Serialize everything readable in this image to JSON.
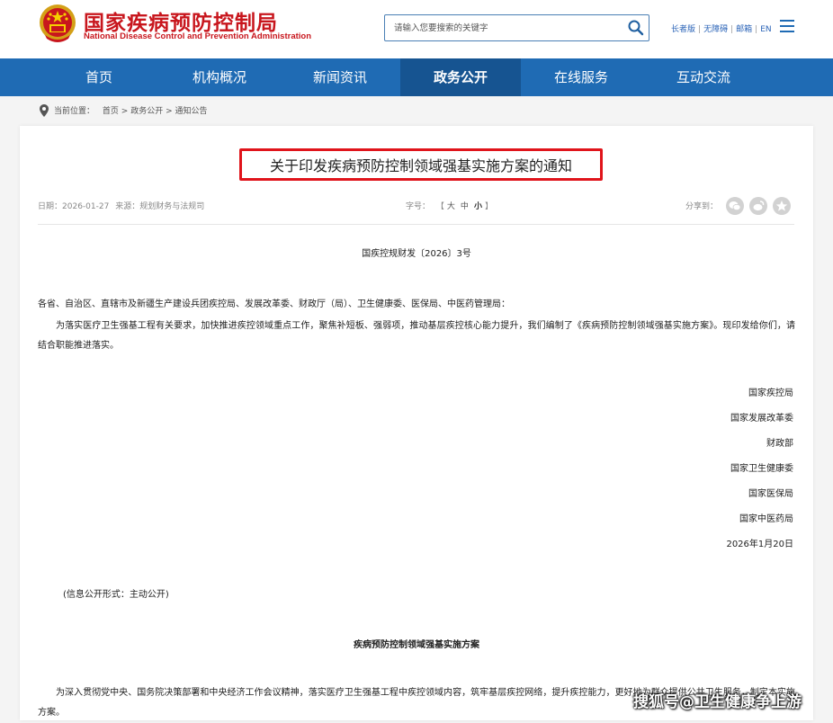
{
  "header": {
    "logo_cn": "国家疾病预防控制局",
    "logo_en": "National Disease Control and Prevention Administration",
    "search_placeholder": "请输入您要搜索的关键字",
    "links": [
      "长者版",
      "无障碍",
      "邮箱",
      "EN"
    ]
  },
  "nav": {
    "items": [
      "首页",
      "机构概况",
      "新闻资讯",
      "政务公开",
      "在线服务",
      "互动交流"
    ],
    "active": "政务公开"
  },
  "breadcrumb": {
    "label": "当前位置：",
    "items": [
      "首页",
      "政务公开",
      "通知公告"
    ],
    "separator": ">"
  },
  "article": {
    "title": "关于印发疾病预防控制领域强基实施方案的通知",
    "date_label": "日期：",
    "date": "2026-01-27",
    "source_label": "来源：",
    "source": "规划财务与法规司",
    "fontsize_label": "字号：",
    "fontsize_options": [
      "大",
      "中",
      "小"
    ],
    "share_label": "分享到：",
    "doc_number": "国疾控规财发〔2026〕3号",
    "addressees": "各省、自治区、直辖市及新疆生产建设兵团疾控局、发展改革委、财政厅（局）、卫生健康委、医保局、中医药管理局：",
    "body": "为落实医疗卫生强基工程有关要求，加快推进疾控领域重点工作，聚焦补短板、强弱项，推动基层疾控核心能力提升，我们编制了《疾病预防控制领域强基实施方案》。现印发给你们，请结合职能推进落实。",
    "signatures": [
      "国家疾控局",
      "国家发展改革委",
      "财政部",
      "国家卫生健康委",
      "国家医保局",
      "国家中医药局"
    ],
    "sign_date": "2026年1月20日",
    "disclosure": "(信息公开形式：主动公开)",
    "plan_title": "疾病预防控制领域强基实施方案",
    "plan_intro": "为深入贯彻党中央、国务院决策部署和中央经济工作会议精神，落实医疗卫生强基工程中疾控领域内容，筑牢基层疾控网络，提升疾控能力，更好地为群众提供公共卫生服务，制定本实施方案。"
  },
  "watermark": "搜狐号@卫生健康争上游",
  "colors": {
    "brand_red": "#c8161d",
    "nav_blue": "#1f6bb4",
    "nav_active": "#165491",
    "title_border": "#e0141b"
  }
}
